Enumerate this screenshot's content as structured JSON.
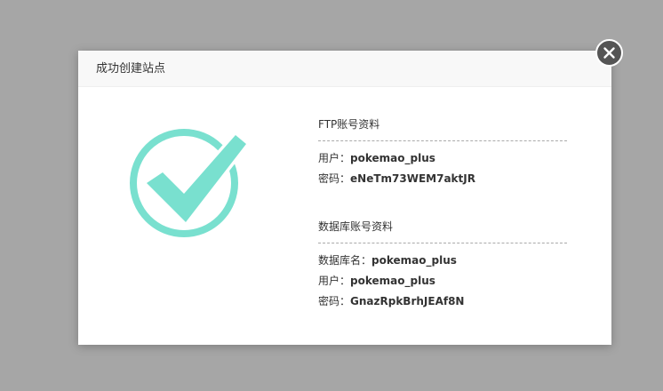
{
  "dialog": {
    "title": "成功创建站点"
  },
  "colors": {
    "overlay": "#a6a6a6",
    "check": "#79e0cf",
    "close_button": "#555555"
  },
  "icons": {
    "success": "checkmark-circle-icon",
    "close": "close-icon"
  },
  "ftp": {
    "title": "FTP账号资料",
    "user_label": "用户：",
    "user_value": "pokemao_plus",
    "password_label": "密码：",
    "password_value": "eNeTm73WEM7aktJR"
  },
  "database": {
    "title": "数据库账号资料",
    "name_label": "数据库名：",
    "name_value": "pokemao_plus",
    "user_label": "用户：",
    "user_value": "pokemao_plus",
    "password_label": "密码：",
    "password_value": "GnazRpkBrhJEAf8N"
  }
}
